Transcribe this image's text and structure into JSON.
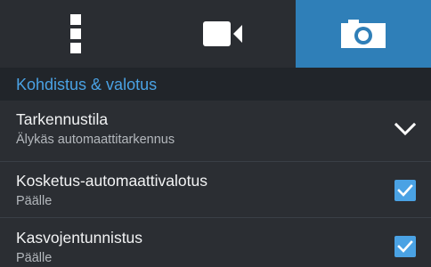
{
  "tabs": [
    {
      "name": "menu",
      "icon": "more-vertical-icon"
    },
    {
      "name": "video",
      "icon": "video-camera-icon"
    },
    {
      "name": "photo",
      "icon": "camera-icon",
      "active": true
    }
  ],
  "section": {
    "title": "Kohdistus & valotus"
  },
  "settings": [
    {
      "title": "Tarkennustila",
      "subtitle": "Älykäs automaattitarkennus",
      "control": "dropdown"
    },
    {
      "title": "Kosketus-automaattivalotus",
      "subtitle": "Päälle",
      "control": "checkbox",
      "checked": true
    },
    {
      "title": "Kasvojentunnistus",
      "subtitle": "Päälle",
      "control": "checkbox",
      "checked": true
    }
  ],
  "colors": {
    "accent": "#4aa2e4",
    "active_tab": "#2f7fb8",
    "background": "#2b2e33",
    "section_background": "#21252a"
  }
}
